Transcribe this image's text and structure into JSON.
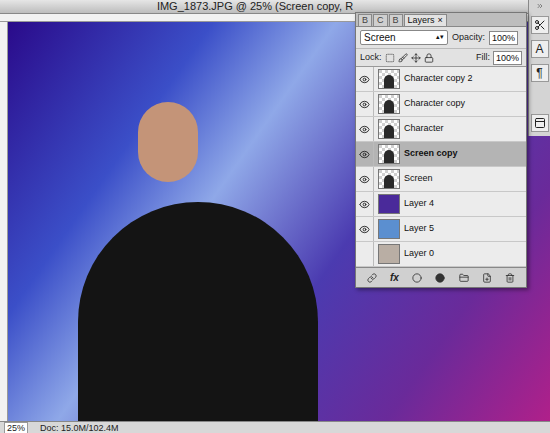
{
  "window": {
    "title": "IMG_1873.JPG @ 25% (Screen copy, R"
  },
  "layers_panel": {
    "tabs": [
      {
        "label": "B",
        "selected": false
      },
      {
        "label": "C",
        "selected": false
      },
      {
        "label": "B",
        "selected": false
      },
      {
        "label": "Layers",
        "selected": true
      }
    ],
    "close": "×",
    "blend_mode": "Screen",
    "opacity_label": "Opacity:",
    "opacity": "100%",
    "lock_label": "Lock:",
    "fill_label": "Fill:",
    "fill": "100%",
    "layers": [
      {
        "name": "Character copy 2",
        "visible": true,
        "selected": false,
        "kind": "checker"
      },
      {
        "name": "Character copy",
        "visible": true,
        "selected": false,
        "kind": "checker"
      },
      {
        "name": "Character",
        "visible": true,
        "selected": false,
        "kind": "checker"
      },
      {
        "name": "Screen copy",
        "visible": true,
        "selected": true,
        "kind": "checker"
      },
      {
        "name": "Screen",
        "visible": true,
        "selected": false,
        "kind": "checker"
      },
      {
        "name": "Layer 4",
        "visible": true,
        "selected": false,
        "kind": "fill",
        "color": "#4a2a9a"
      },
      {
        "name": "Layer 5",
        "visible": true,
        "selected": false,
        "kind": "fill",
        "color": "#5b8fd0"
      },
      {
        "name": "Layer 0",
        "visible": false,
        "selected": false,
        "kind": "fill",
        "color": "#b9aea4"
      }
    ],
    "footer": {
      "fx": "fx"
    }
  },
  "toolbar": {
    "glyphs": [
      "A",
      "¶"
    ]
  },
  "status_bar": {
    "zoom": "25%",
    "doc": "Doc: 15.0M/102.4M"
  }
}
